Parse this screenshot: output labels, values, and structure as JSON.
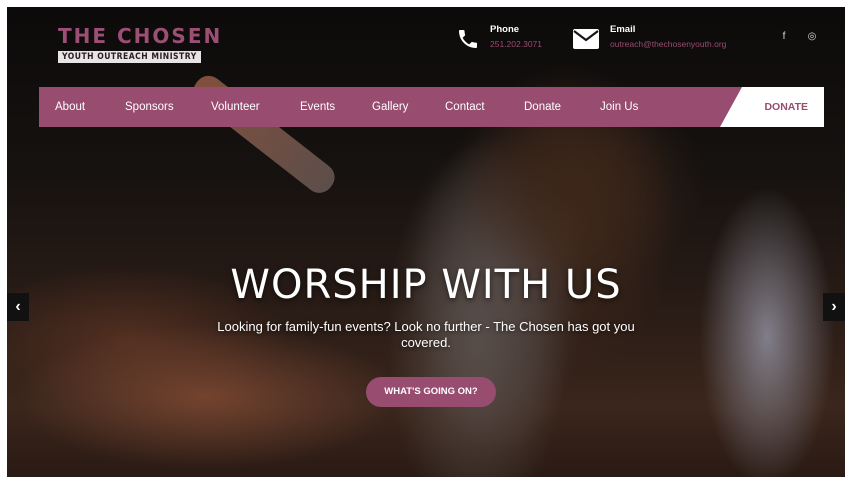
{
  "brand": {
    "title": "THE CHOSEN",
    "subtitle": "YOUTH OUTREACH MINISTRY"
  },
  "contact": {
    "phone": {
      "label": "Phone",
      "value": "251.202.3071",
      "icon": "phone-icon"
    },
    "email": {
      "label": "Email",
      "value": "outreach@thechosenyouth.org",
      "icon": "envelope-icon"
    }
  },
  "social": [
    {
      "icon": "facebook-icon",
      "glyph": "f"
    },
    {
      "icon": "instagram-icon",
      "glyph": "◎"
    }
  ],
  "nav": {
    "items": [
      "About",
      "Sponsors",
      "Volunteer",
      "Events",
      "Gallery",
      "Contact",
      "Donate",
      "Join Us"
    ],
    "donate_button": "DONATE"
  },
  "hero": {
    "title": "WORSHIP WITH US",
    "subtitle": "Looking for family-fun events? Look no further - The Chosen has got you covered.",
    "cta": "WHAT'S GOING ON?"
  },
  "slider": {
    "prev": "‹",
    "next": "›"
  },
  "colors": {
    "accent": "#974c70",
    "brand_text": "#9c4f74"
  }
}
